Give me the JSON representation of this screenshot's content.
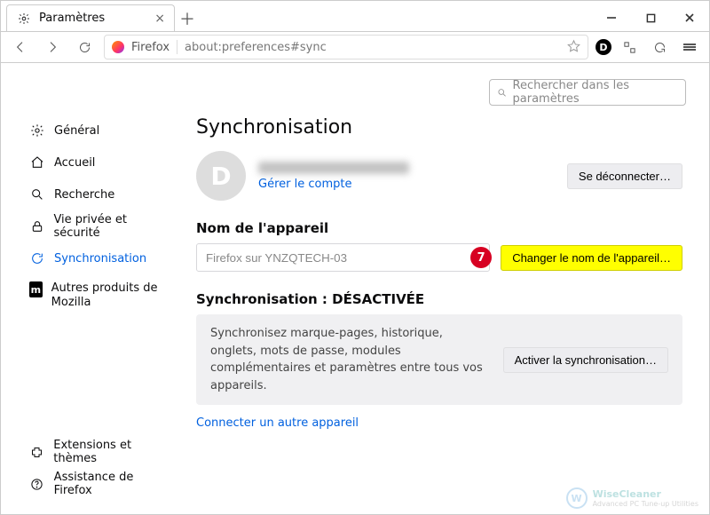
{
  "titlebar": {
    "tab_title": "Paramètres"
  },
  "toolbar": {
    "identity_label": "Firefox",
    "address": "about:preferences#sync"
  },
  "search": {
    "placeholder": "Rechercher dans les paramètres"
  },
  "sidebar": {
    "items": [
      {
        "label": "Général"
      },
      {
        "label": "Accueil"
      },
      {
        "label": "Recherche"
      },
      {
        "label": "Vie privée et sécurité"
      },
      {
        "label": "Synchronisation"
      },
      {
        "label": "Autres produits de Mozilla"
      }
    ],
    "bottom": [
      {
        "label": "Extensions et thèmes"
      },
      {
        "label": "Assistance de Firefox"
      }
    ]
  },
  "main": {
    "heading": "Synchronisation",
    "avatar_letter": "D",
    "manage_account": "Gérer le compte",
    "disconnect": "Se déconnecter…",
    "device_heading": "Nom de l'appareil",
    "device_value": "Firefox sur YNZQTECH-03",
    "change_device": "Changer le nom de l'appareil…",
    "callout_number": "7",
    "sync_status_heading": "Synchronisation : DÉSACTIVÉE",
    "sync_desc": "Synchronisez marque-pages, historique, onglets, mots de passe, modules complémentaires et paramètres entre tous vos appareils.",
    "activate_sync": "Activer la synchronisation…",
    "connect_other": "Connecter un autre appareil"
  },
  "watermark": {
    "name": "WiseCleaner",
    "tagline": "Advanced PC Tune-up Utilities"
  }
}
